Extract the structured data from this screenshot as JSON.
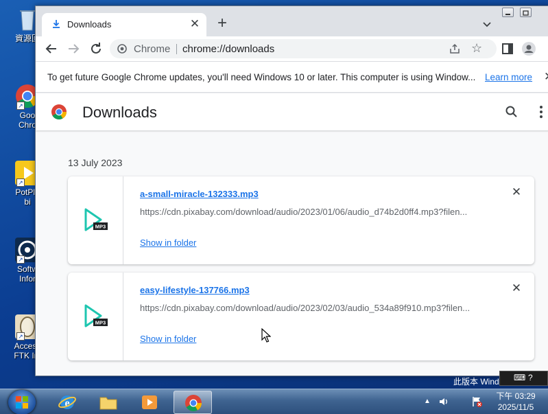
{
  "desktop": {
    "icons": [
      {
        "label": "資源回"
      },
      {
        "label": "Goo"
      },
      {
        "label": "Chro"
      },
      {
        "label": "PotPla"
      },
      {
        "label": "bi"
      },
      {
        "label": "Softw"
      },
      {
        "label": "Infor"
      },
      {
        "label": "Access"
      },
      {
        "label": "FTK Im"
      }
    ],
    "watermark": "此版本 Wind"
  },
  "browser": {
    "tab_title": "Downloads",
    "omnibox_chip": "Chrome",
    "url": "chrome://downloads",
    "infobar": {
      "message": "To get future Google Chrome updates, you'll need Windows 10 or later. This computer is using Window...",
      "link": "Learn more"
    }
  },
  "page": {
    "title": "Downloads",
    "date_heading": "13 July 2023",
    "downloads": [
      {
        "filename": "a-small-miracle-132333.mp3",
        "url": "https://cdn.pixabay.com/download/audio/2023/01/06/audio_d74b2d0ff4.mp3?filen...",
        "action": "Show in folder",
        "icon_badge": "MP3"
      },
      {
        "filename": "easy-lifestyle-137766.mp3",
        "url": "https://cdn.pixabay.com/download/audio/2023/02/03/audio_534a89f910.mp3?filen...",
        "action": "Show in folder",
        "icon_badge": "MP3"
      }
    ]
  },
  "taskbar": {
    "clock_time": "下午 03:29",
    "clock_date": "2025/11/5"
  },
  "colors": {
    "accent": "#1a73e8",
    "file_icon": "#1ec6b0",
    "taskbar": "#3f6491"
  }
}
